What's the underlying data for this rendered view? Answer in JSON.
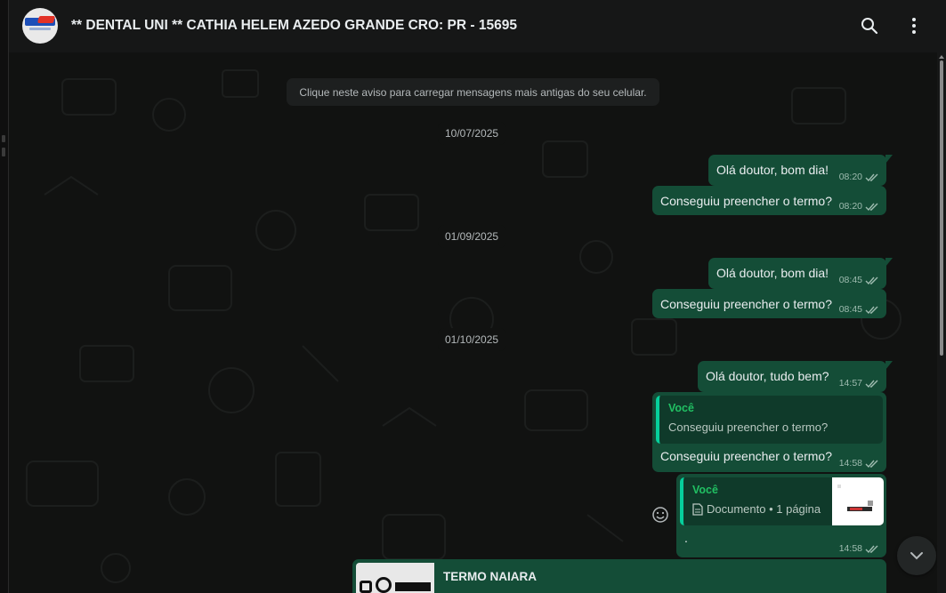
{
  "colors": {
    "background": "#161717",
    "chat_bg": "#111211",
    "outgoing_bubble": "#144d37",
    "quote_accent": "#06cf9c",
    "quote_name": "#21c063",
    "text_primary": "#e9edef",
    "text_secondary": "#b4b9bb"
  },
  "header": {
    "contact_name": "** DENTAL UNI ** CATHIA HELEM AZEDO GRANDE CRO: PR - 15695",
    "avatar_icon": "contact-avatar-icon",
    "search_icon": "search-icon",
    "menu_icon": "more-vertical-icon"
  },
  "chat": {
    "load_older_notice": "Clique neste aviso para carregar mensagens mais antigas do seu celular.",
    "dates": [
      "10/07/2025",
      "01/09/2025",
      "01/10/2025"
    ],
    "messages": [
      {
        "text": "Olá doutor, bom dia!",
        "time": "08:20",
        "status": "read-icon"
      },
      {
        "text": "Conseguiu preencher o termo?",
        "time": "08:20",
        "status": "read-icon"
      },
      {
        "text": "Olá doutor, bom dia!",
        "time": "08:45",
        "status": "read-icon"
      },
      {
        "text": "Conseguiu preencher o termo?",
        "time": "08:45",
        "status": "read-icon"
      },
      {
        "text": "Olá doutor, tudo bem?",
        "time": "14:57",
        "status": "read-icon"
      },
      {
        "quote_author": "Você",
        "quote_text": "Conseguiu preencher o termo?",
        "text": "Conseguiu preencher o termo?",
        "time": "14:58",
        "status": "read-icon"
      },
      {
        "quote_author": "Você",
        "quote_doc_label": "Documento • 1 página",
        "text": ".",
        "time": "14:58",
        "status": "read-icon"
      }
    ],
    "bottom_document": {
      "title": "TERMO NAIARA"
    },
    "emoji_icon": "emoji-smile-icon",
    "scroll_down_icon": "chevron-down-icon"
  }
}
